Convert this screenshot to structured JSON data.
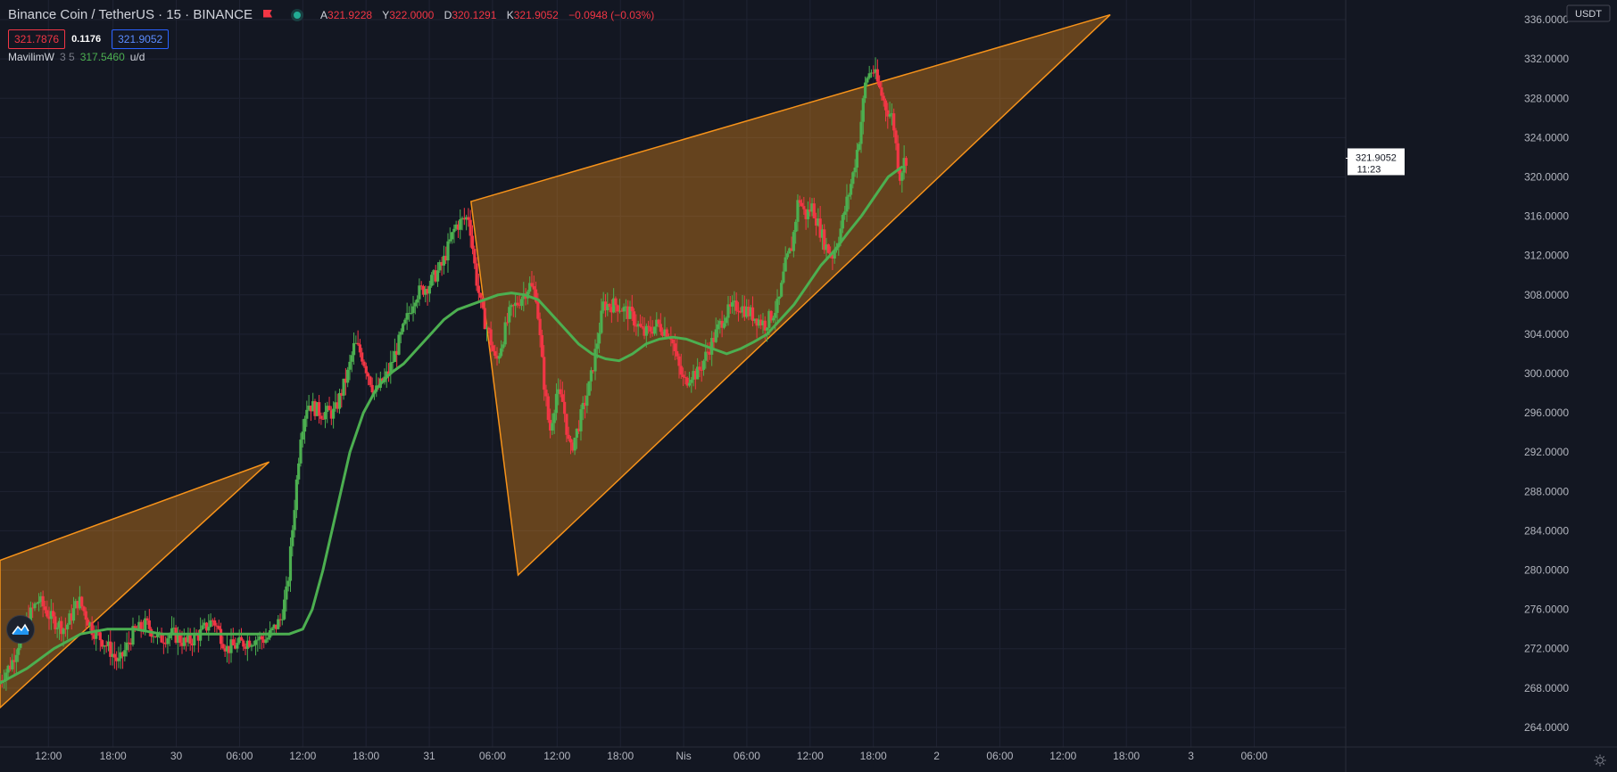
{
  "header": {
    "symbol": "Binance Coin / TetherUS · 15 · BINANCE",
    "ohlc": [
      {
        "key": "A",
        "value": "321.9228"
      },
      {
        "key": "Y",
        "value": "322.0000"
      },
      {
        "key": "D",
        "value": "320.1291"
      },
      {
        "key": "K",
        "value": "321.9052"
      }
    ],
    "change": "−0.0948 (−0.03%)",
    "sell_price": "321.7876",
    "spread": "0.1176",
    "buy_price": "321.9052"
  },
  "indicator": {
    "name": "MavilimW",
    "params": "3 5",
    "value": "317.5460",
    "unit": "u/d"
  },
  "colors": {
    "background": "#131722",
    "up": "#26a69a",
    "down": "#ef5350",
    "candle_up": "#4caf50",
    "candle_down": "#f23645",
    "ma": "#4caf50",
    "wedge": "#f7931a",
    "grid": "#1f2333"
  },
  "icons": [
    "flag-icon",
    "live-dot-icon",
    "tradingview-logo-icon",
    "settings-gear-icon"
  ],
  "chart_data": {
    "type": "candlestick",
    "currency": "USDT",
    "last_price": "321.9052",
    "countdown": "11:23",
    "ylim": [
      262,
      338
    ],
    "xlim": [
      0,
      1000
    ],
    "y_ticks": [
      "264.0000",
      "268.0000",
      "272.0000",
      "276.0000",
      "280.0000",
      "284.0000",
      "288.0000",
      "292.0000",
      "296.0000",
      "300.0000",
      "304.0000",
      "308.0000",
      "312.0000",
      "316.0000",
      "320.0000",
      "324.0000",
      "328.0000",
      "332.0000",
      "336.0000"
    ],
    "x_ticks": [
      {
        "x": 36,
        "label": "12:00"
      },
      {
        "x": 84,
        "label": "18:00"
      },
      {
        "x": 131,
        "label": "30"
      },
      {
        "x": 178,
        "label": "06:00"
      },
      {
        "x": 225,
        "label": "12:00"
      },
      {
        "x": 272,
        "label": "18:00"
      },
      {
        "x": 319,
        "label": "31"
      },
      {
        "x": 366,
        "label": "06:00"
      },
      {
        "x": 414,
        "label": "12:00"
      },
      {
        "x": 461,
        "label": "18:00"
      },
      {
        "x": 508,
        "label": "Nis"
      },
      {
        "x": 555,
        "label": "06:00"
      },
      {
        "x": 602,
        "label": "12:00"
      },
      {
        "x": 649,
        "label": "18:00"
      },
      {
        "x": 696,
        "label": "2"
      },
      {
        "x": 743,
        "label": "06:00"
      },
      {
        "x": 790,
        "label": "12:00"
      },
      {
        "x": 837,
        "label": "18:00"
      },
      {
        "x": 885,
        "label": "3"
      },
      {
        "x": 932,
        "label": "06:00"
      }
    ],
    "price_path": [
      [
        0,
        268.5
      ],
      [
        10,
        270.5
      ],
      [
        20,
        274.5
      ],
      [
        30,
        277
      ],
      [
        40,
        275
      ],
      [
        50,
        274
      ],
      [
        60,
        277
      ],
      [
        70,
        274
      ],
      [
        80,
        272.5
      ],
      [
        90,
        270.5
      ],
      [
        100,
        273.5
      ],
      [
        110,
        274.5
      ],
      [
        120,
        273
      ],
      [
        130,
        273.5
      ],
      [
        140,
        272.5
      ],
      [
        150,
        273.5
      ],
      [
        160,
        275
      ],
      [
        170,
        272
      ],
      [
        180,
        272.5
      ],
      [
        190,
        273
      ],
      [
        200,
        273
      ],
      [
        210,
        275
      ],
      [
        215,
        278
      ],
      [
        220,
        286
      ],
      [
        225,
        294
      ],
      [
        230,
        297
      ],
      [
        240,
        296
      ],
      [
        250,
        296
      ],
      [
        260,
        300
      ],
      [
        265,
        303
      ],
      [
        270,
        302
      ],
      [
        280,
        298
      ],
      [
        290,
        300
      ],
      [
        300,
        304
      ],
      [
        310,
        308
      ],
      [
        320,
        309
      ],
      [
        330,
        311
      ],
      [
        340,
        315
      ],
      [
        350,
        316
      ],
      [
        355,
        310
      ],
      [
        360,
        306
      ],
      [
        365,
        304
      ],
      [
        370,
        301
      ],
      [
        380,
        306
      ],
      [
        390,
        308
      ],
      [
        395,
        309
      ],
      [
        400,
        308
      ],
      [
        405,
        300
      ],
      [
        410,
        294
      ],
      [
        415,
        298
      ],
      [
        420,
        297
      ],
      [
        425,
        292
      ],
      [
        430,
        294
      ],
      [
        440,
        299
      ],
      [
        450,
        307
      ],
      [
        460,
        307
      ],
      [
        470,
        306
      ],
      [
        480,
        304
      ],
      [
        490,
        305
      ],
      [
        500,
        304
      ],
      [
        505,
        301
      ],
      [
        510,
        299
      ],
      [
        515,
        300
      ],
      [
        520,
        300
      ],
      [
        530,
        303
      ],
      [
        540,
        306
      ],
      [
        550,
        307
      ],
      [
        560,
        306
      ],
      [
        570,
        305
      ],
      [
        580,
        307
      ],
      [
        585,
        311
      ],
      [
        590,
        313
      ],
      [
        595,
        318
      ],
      [
        600,
        316
      ],
      [
        605,
        317
      ],
      [
        610,
        315
      ],
      [
        615,
        313
      ],
      [
        620,
        312
      ],
      [
        625,
        314
      ],
      [
        630,
        317
      ],
      [
        635,
        320
      ],
      [
        640,
        324
      ],
      [
        645,
        330
      ],
      [
        650,
        331
      ],
      [
        655,
        329
      ],
      [
        660,
        327
      ],
      [
        665,
        326
      ],
      [
        670,
        320
      ],
      [
        674,
        321.9
      ]
    ],
    "ma_path": [
      [
        0,
        268.5
      ],
      [
        20,
        270
      ],
      [
        40,
        272
      ],
      [
        60,
        273.5
      ],
      [
        80,
        274
      ],
      [
        100,
        274
      ],
      [
        120,
        273.5
      ],
      [
        140,
        273.5
      ],
      [
        160,
        273.5
      ],
      [
        180,
        273.5
      ],
      [
        200,
        273.5
      ],
      [
        215,
        273.5
      ],
      [
        225,
        274
      ],
      [
        232,
        276
      ],
      [
        240,
        280
      ],
      [
        250,
        286
      ],
      [
        260,
        292
      ],
      [
        270,
        296
      ],
      [
        280,
        298.5
      ],
      [
        290,
        300
      ],
      [
        300,
        301
      ],
      [
        310,
        302.5
      ],
      [
        320,
        304
      ],
      [
        330,
        305.5
      ],
      [
        340,
        306.5
      ],
      [
        350,
        307
      ],
      [
        360,
        307.5
      ],
      [
        370,
        308
      ],
      [
        380,
        308.2
      ],
      [
        390,
        308
      ],
      [
        400,
        307.5
      ],
      [
        410,
        306
      ],
      [
        420,
        304.5
      ],
      [
        430,
        303
      ],
      [
        440,
        302
      ],
      [
        450,
        301.5
      ],
      [
        460,
        301.3
      ],
      [
        470,
        302
      ],
      [
        480,
        303
      ],
      [
        490,
        303.5
      ],
      [
        500,
        303.7
      ],
      [
        510,
        303.5
      ],
      [
        520,
        303
      ],
      [
        530,
        302.5
      ],
      [
        540,
        302
      ],
      [
        550,
        302.5
      ],
      [
        560,
        303.2
      ],
      [
        570,
        304
      ],
      [
        580,
        305.5
      ],
      [
        590,
        307
      ],
      [
        600,
        309
      ],
      [
        610,
        311
      ],
      [
        620,
        312.5
      ],
      [
        630,
        314.3
      ],
      [
        640,
        316
      ],
      [
        650,
        318
      ],
      [
        660,
        320
      ],
      [
        670,
        321
      ]
    ],
    "wedges": [
      {
        "name": "left-wedge",
        "points": [
          [
            0,
            281
          ],
          [
            200,
            291
          ],
          [
            0,
            266
          ]
        ]
      },
      {
        "name": "right-wedge",
        "points": [
          [
            350,
            317.5
          ],
          [
            825,
            336.5
          ],
          [
            385,
            279.5
          ]
        ]
      }
    ],
    "grid": true
  }
}
